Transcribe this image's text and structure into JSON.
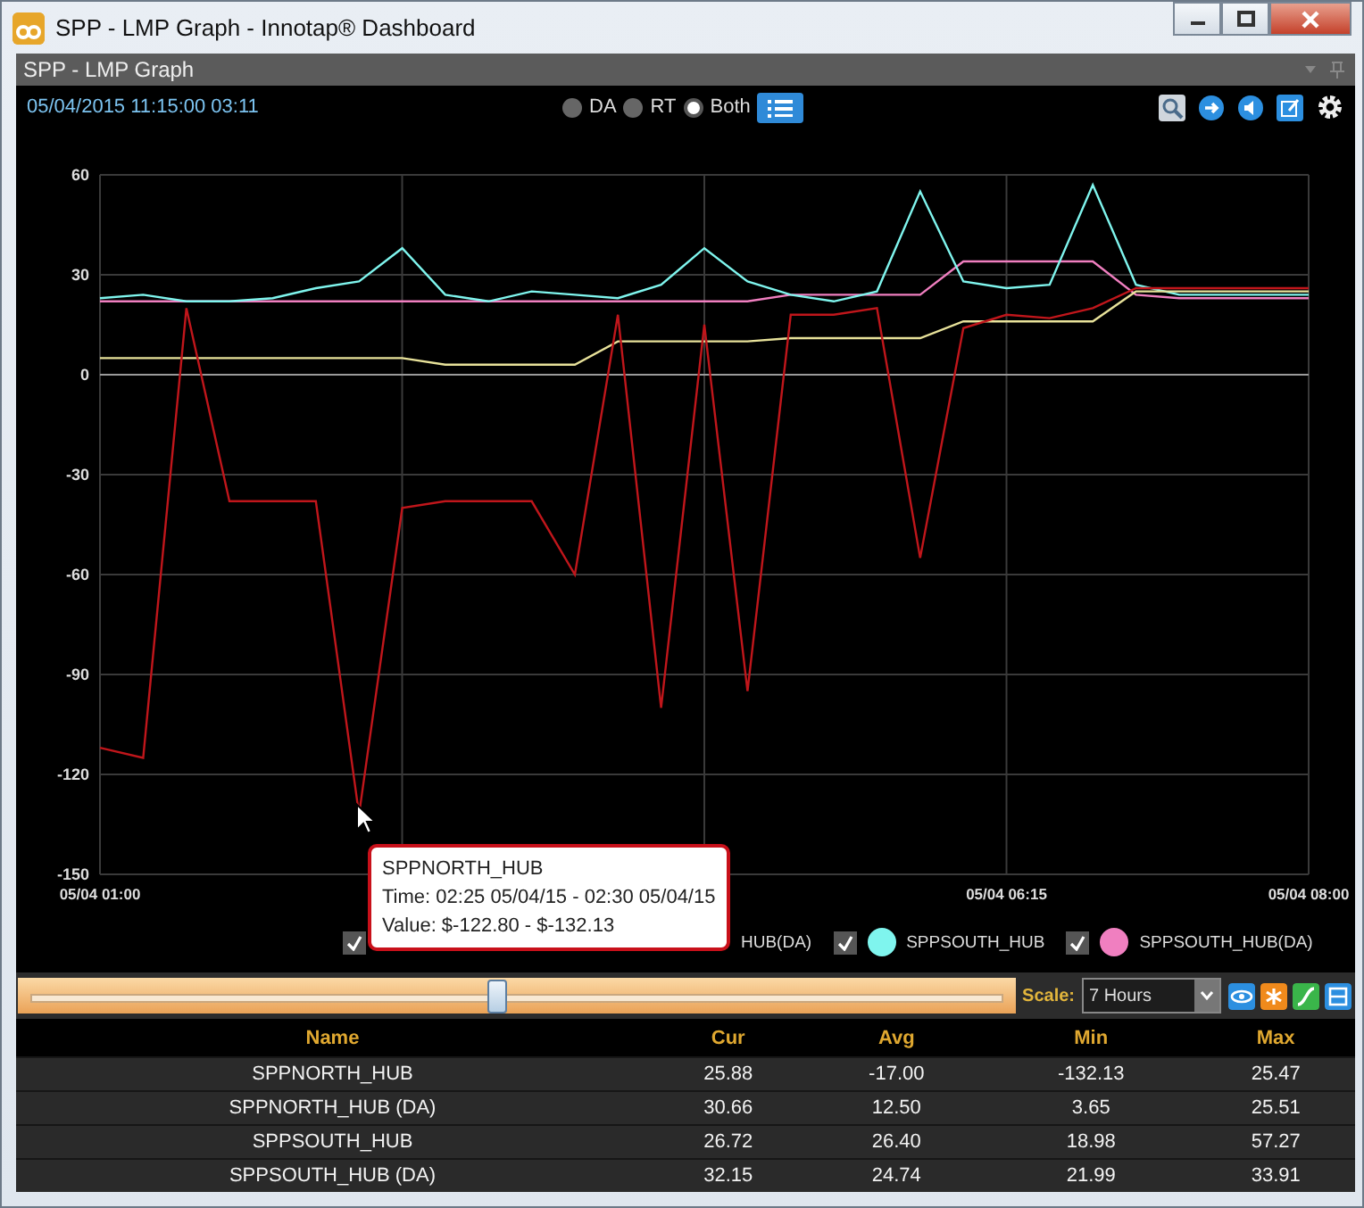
{
  "window": {
    "title": "SPP - LMP Graph - Innotap® Dashboard"
  },
  "panel": {
    "title": "SPP - LMP Graph",
    "toolbar": {
      "datetime": "05/04/2015 11:15:00  03:11",
      "modes": [
        {
          "label": "DA",
          "selected": false
        },
        {
          "label": "RT",
          "selected": false
        },
        {
          "label": "Both",
          "selected": true
        }
      ]
    },
    "chart_data": {
      "type": "line",
      "grid": true,
      "ylim": [
        -150,
        60
      ],
      "yticks": [
        60,
        30,
        0,
        -30,
        -60,
        -90,
        -120,
        -150
      ],
      "categories": [
        "05/04 01:00",
        null,
        null,
        null,
        null,
        null,
        null,
        null,
        null,
        null,
        null,
        null,
        null,
        null,
        null,
        null,
        null,
        null,
        null,
        null,
        null,
        "05/04 06:15",
        null,
        null,
        null,
        null,
        null,
        null,
        "05/04 08:00"
      ],
      "series": [
        {
          "color": "#c0161b",
          "values": [
            -112,
            -115,
            20,
            -38,
            -38,
            -38,
            -132,
            -40,
            -38,
            -38,
            -38,
            -60,
            18,
            -100,
            15,
            -95,
            18,
            18,
            20,
            -55,
            14,
            18,
            17,
            20,
            26,
            26,
            26,
            26,
            26
          ]
        },
        {
          "color": "#e8e29a",
          "values": [
            5,
            5,
            5,
            5,
            5,
            5,
            5,
            5,
            3,
            3,
            3,
            3,
            10,
            10,
            10,
            10,
            11,
            11,
            11,
            11,
            16,
            16,
            16,
            16,
            25,
            25,
            25,
            25,
            25
          ]
        },
        {
          "color": "#7ff5ee",
          "values": [
            23,
            24,
            22,
            22,
            23,
            26,
            28,
            38,
            24,
            22,
            25,
            24,
            23,
            27,
            38,
            28,
            24,
            22,
            25,
            55,
            28,
            26,
            27,
            57,
            27,
            24,
            24,
            24,
            24
          ]
        },
        {
          "color": "#f07fc0",
          "values": [
            22,
            22,
            22,
            22,
            22,
            22,
            22,
            22,
            22,
            22,
            22,
            22,
            22,
            22,
            22,
            22,
            24,
            24,
            24,
            24,
            34,
            34,
            34,
            34,
            24,
            23,
            23,
            23,
            23
          ]
        }
      ]
    },
    "legend": [
      {
        "checked": true
      },
      {
        "label": "HUB(DA)"
      },
      {
        "checked": true,
        "color": "#7ff5ee",
        "label": "SPPSOUTH_HUB"
      },
      {
        "checked": true,
        "color": "#f07fc0",
        "label": "SPPSOUTH_HUB(DA)"
      }
    ],
    "tooltip": {
      "title": "SPPNORTH_HUB",
      "lines": [
        "Time: 02:25 05/04/15 - 02:30 05/04/15",
        "Value: $-122.80 - $-132.13"
      ]
    },
    "timeline": {
      "level": 0.48,
      "scale_label": "Scale:",
      "scale_value": "7 Hours"
    },
    "table": {
      "columns": [
        "Name",
        "Cur",
        "Avg",
        "Min",
        "Max"
      ],
      "rows": [
        [
          "SPPNORTH_HUB",
          "25.88",
          "-17.00",
          "-132.13",
          "25.47"
        ],
        [
          "SPPNORTH_HUB (DA)",
          "30.66",
          "12.50",
          "3.65",
          "25.51"
        ],
        [
          "SPPSOUTH_HUB",
          "26.72",
          "26.40",
          "18.98",
          "57.27"
        ],
        [
          "SPPSOUTH_HUB (DA)",
          "32.15",
          "24.74",
          "21.99",
          "33.91"
        ]
      ]
    }
  }
}
